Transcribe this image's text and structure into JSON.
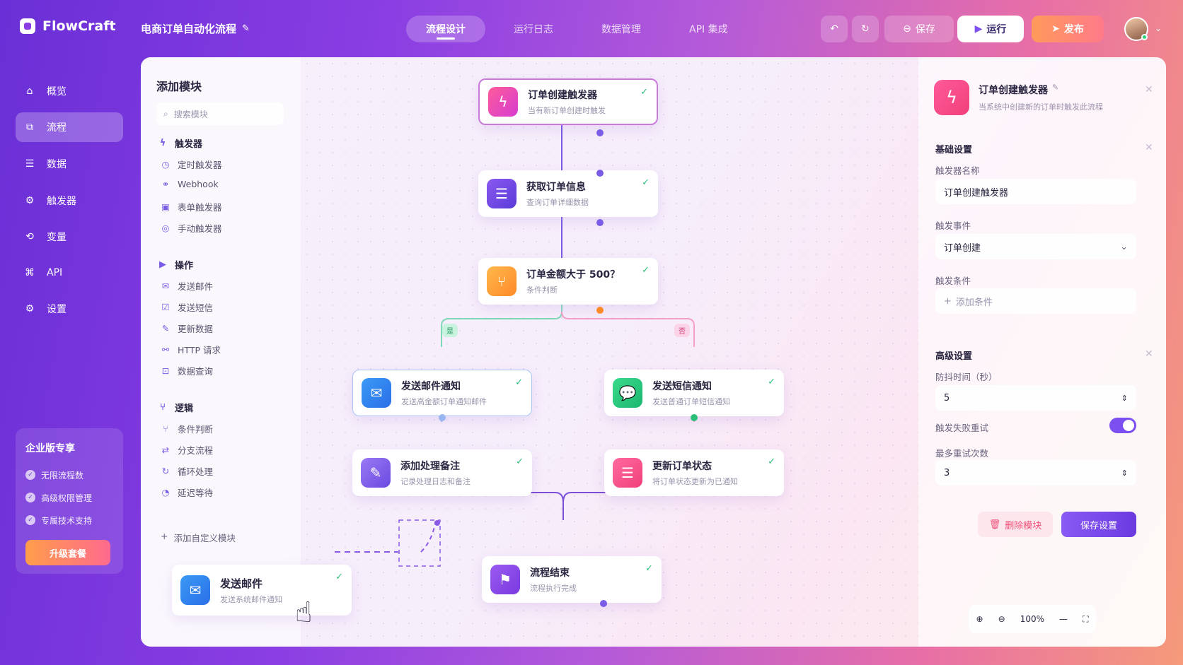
{
  "app": {
    "name": "FlowCraft",
    "project": "电商订单自动化流程"
  },
  "tabs": [
    "流程设计",
    "运行日志",
    "数据管理",
    "API 集成"
  ],
  "toolbar": {
    "save": "保存",
    "run": "运行",
    "publish": "发布"
  },
  "nav": [
    "概览",
    "流程",
    "数据",
    "触发器",
    "变量",
    "API",
    "设置"
  ],
  "enterprise": {
    "title": "企业版专享",
    "features": [
      "无限流程数",
      "高级权限管理",
      "专属技术支持"
    ],
    "upgrade": "升级套餐"
  },
  "modules": {
    "title": "添加模块",
    "search_placeholder": "搜索模块",
    "groups": [
      {
        "name": "触发器",
        "items": [
          "定时触发器",
          "Webhook",
          "表单触发器",
          "手动触发器"
        ]
      },
      {
        "name": "操作",
        "items": [
          "发送邮件",
          "发送短信",
          "更新数据",
          "HTTP 请求",
          "数据查询"
        ]
      },
      {
        "name": "逻辑",
        "items": [
          "条件判断",
          "分支流程",
          "循环处理",
          "延迟等待"
        ]
      }
    ],
    "add_custom": "添加自定义模块"
  },
  "nodes": {
    "trigger": {
      "title": "订单创建触发器",
      "sub": "当有新订单创建时触发"
    },
    "fetch": {
      "title": "获取订单信息",
      "sub": "查询订单详细数据"
    },
    "cond": {
      "title": "订单金额大于 500？",
      "sub": "条件判断"
    },
    "email": {
      "title": "发送邮件通知",
      "sub": "发送高金额订单通知邮件"
    },
    "sms": {
      "title": "发送短信通知",
      "sub": "发送普通订单短信通知"
    },
    "note": {
      "title": "添加处理备注",
      "sub": "记录处理日志和备注"
    },
    "update": {
      "title": "更新订单状态",
      "sub": "将订单状态更新为已通知"
    },
    "end": {
      "title": "流程结束",
      "sub": "流程执行完成"
    },
    "drag": {
      "title": "发送邮件",
      "sub": "发送系统邮件通知"
    }
  },
  "branch": {
    "yes": "是",
    "no": "否"
  },
  "props": {
    "title": "订单创建触发器",
    "sub": "当系统中创建新的订单时触发此流程",
    "basic": "基础设置",
    "name_label": "触发器名称",
    "name_value": "订单创建触发器",
    "event_label": "触发事件",
    "event_value": "订单创建",
    "cond_label": "触发条件",
    "add_cond": "添加条件",
    "adv": "高级设置",
    "debounce_label": "防抖时间（秒）",
    "debounce_value": "5",
    "retry_label": "触发失败重试",
    "retry_on": true,
    "max_label": "最多重试次数",
    "max_value": "3",
    "delete": "删除模块",
    "save": "保存设置"
  },
  "zoom": "100%",
  "colors": {
    "accent": "#7b4ff0",
    "success": "#2bbf7a",
    "pink": "#f0508a"
  }
}
